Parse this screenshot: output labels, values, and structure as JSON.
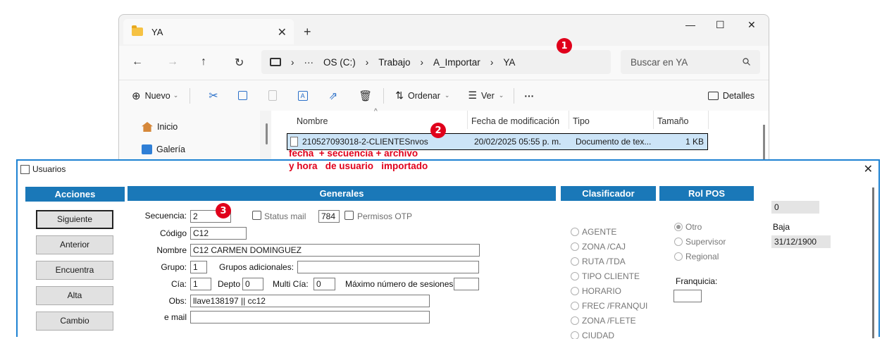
{
  "explorer": {
    "tab_title": "YA",
    "tab_close": "✕",
    "new_tab": "+",
    "window_controls": {
      "minimize": "—",
      "maximize": "☐",
      "close": "✕"
    },
    "nav": {
      "back": "←",
      "forward": "→",
      "up": "↑",
      "refresh": "↻"
    },
    "breadcrumb": [
      "OS (C:)",
      "Trabajo",
      "A_Importar",
      "YA"
    ],
    "breadcrumb_sep": "›",
    "breadcrumb_more": "···",
    "search_placeholder": "Buscar en YA",
    "toolbar": {
      "new_label": "Nuevo",
      "sort_label": "Ordenar",
      "view_label": "Ver",
      "more_label": "···",
      "details_label": "Detalles"
    },
    "sidebar": [
      {
        "label": "Inicio",
        "icon": "home-icon"
      },
      {
        "label": "Galería",
        "icon": "gallery-icon"
      }
    ],
    "columns": [
      "Nombre",
      "Fecha de modificación",
      "Tipo",
      "Tamaño"
    ],
    "files": [
      {
        "name": "210527093018-2-CLIENTESnvos",
        "modified": "20/02/2025 05:55 p. m.",
        "type": "Documento de tex...",
        "size": "1 KB"
      }
    ]
  },
  "annotations": {
    "badge1": "1",
    "badge2": "2",
    "badge3": "3",
    "note": "fecha  + secuencia + archivo\ny hora   de usuario   importado"
  },
  "dialog": {
    "title": "Usuarios",
    "close": "✕",
    "sections": {
      "actions": "Acciones",
      "general": "Generales",
      "classifier": "Clasificador",
      "pos_role": "Rol POS"
    },
    "buttons": [
      "Siguiente",
      "Anterior",
      "Encuentra",
      "Alta",
      "Cambio"
    ],
    "fields": {
      "secuencia_label": "Secuencia:",
      "secuencia_value": "2",
      "status_mail_label": "Status mail",
      "status_mail_value": "784",
      "permisos_otp_label": "Permisos OTP",
      "codigo_label": "Código",
      "codigo_value": "C12",
      "nombre_label": "Nombre",
      "nombre_value": "C12 CARMEN DOMINGUEZ",
      "grupo_label": "Grupo:",
      "grupo_value": "1",
      "grupos_adicionales_label": "Grupos adicionales:",
      "grupos_adicionales_value": "",
      "cia_label": "Cía:",
      "cia_value": "1",
      "depto_label": "Depto",
      "depto_value": "0",
      "multi_cia_label": "Multi Cía:",
      "multi_cia_value": "0",
      "max_sesiones_label": "Máximo número de sesiones:",
      "max_sesiones_value": "",
      "obs_label": "Obs:",
      "obs_value": "llave138197 || cc12",
      "email_label": "e mail",
      "email_value": ""
    },
    "classifier_options": [
      "AGENTE",
      "ZONA /CAJ",
      "RUTA /TDA",
      "TIPO CLIENTE",
      "HORARIO",
      "FREC /FRANQUI",
      "ZONA /FLETE",
      "CIUDAD"
    ],
    "pos_roles": [
      "Otro",
      "Supervisor",
      "Regional"
    ],
    "pos_role_selected": "Otro",
    "franquicia_label": "Franquicia:",
    "franquicia_value": "",
    "right_panel": {
      "value": "0",
      "baja_label": "Baja",
      "baja_date": "31/12/1900"
    }
  }
}
